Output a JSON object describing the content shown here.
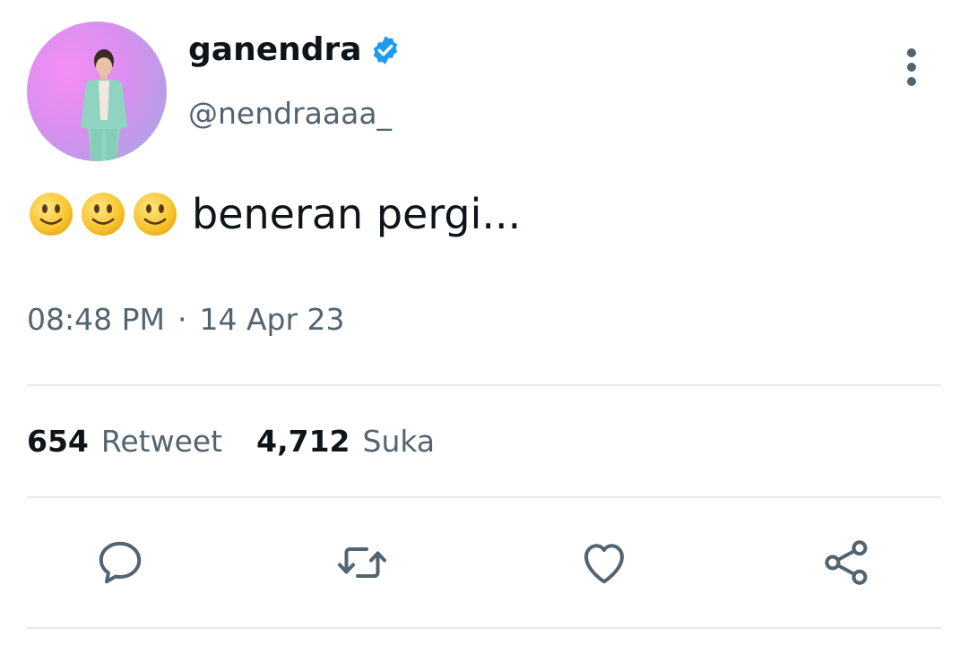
{
  "author": {
    "display_name": "ganendra",
    "handle": "@nendraaaa_",
    "verified": true,
    "avatar": "avatar-photo-person-mint-suit",
    "badge_color": "#1d9bf0"
  },
  "tweet": {
    "emojis": [
      "slightly-smiling-face",
      "slightly-smiling-face",
      "slightly-smiling-face"
    ],
    "text": "beneran pergi..."
  },
  "meta": {
    "time": "08:48 PM",
    "separator": "·",
    "date": "14 Apr 23"
  },
  "stats": {
    "retweets": {
      "count": "654",
      "label": "Retweet"
    },
    "likes": {
      "count": "4,712",
      "label": "Suka"
    }
  },
  "actions": {
    "icons": [
      "reply-icon",
      "retweet-icon",
      "like-icon",
      "share-icon"
    ]
  },
  "colors": {
    "text_primary": "#0f1419",
    "text_secondary": "#536471",
    "divider": "#e7e9ea"
  }
}
